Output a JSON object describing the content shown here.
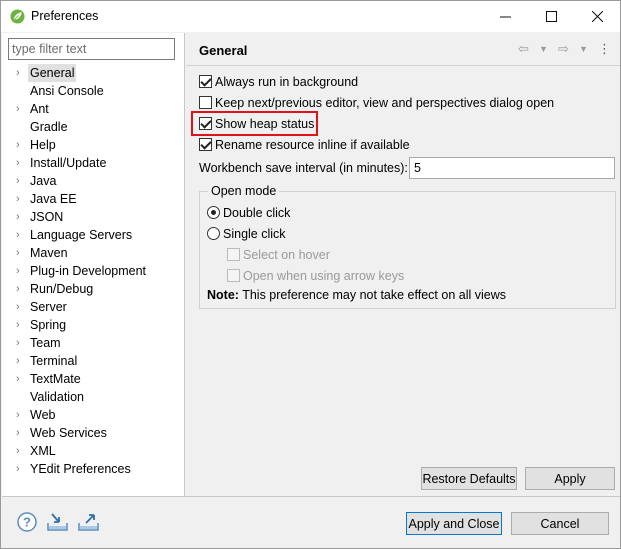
{
  "window": {
    "title": "Preferences",
    "minimize_glyph": "—",
    "maximize_glyph": "☐",
    "close_glyph": "✕"
  },
  "sidebar": {
    "filter_placeholder": "type filter text",
    "items": [
      {
        "label": "General",
        "has_arrow": true,
        "selected": true
      },
      {
        "label": "Ansi Console",
        "has_arrow": false
      },
      {
        "label": "Ant",
        "has_arrow": true
      },
      {
        "label": "Gradle",
        "has_arrow": false
      },
      {
        "label": "Help",
        "has_arrow": true
      },
      {
        "label": "Install/Update",
        "has_arrow": true
      },
      {
        "label": "Java",
        "has_arrow": true
      },
      {
        "label": "Java EE",
        "has_arrow": true
      },
      {
        "label": "JSON",
        "has_arrow": true
      },
      {
        "label": "Language Servers",
        "has_arrow": true
      },
      {
        "label": "Maven",
        "has_arrow": true
      },
      {
        "label": "Plug-in Development",
        "has_arrow": true
      },
      {
        "label": "Run/Debug",
        "has_arrow": true
      },
      {
        "label": "Server",
        "has_arrow": true
      },
      {
        "label": "Spring",
        "has_arrow": true
      },
      {
        "label": "Team",
        "has_arrow": true
      },
      {
        "label": "Terminal",
        "has_arrow": true
      },
      {
        "label": "TextMate",
        "has_arrow": true
      },
      {
        "label": "Validation",
        "has_arrow": false
      },
      {
        "label": "Web",
        "has_arrow": true
      },
      {
        "label": "Web Services",
        "has_arrow": true
      },
      {
        "label": "XML",
        "has_arrow": true
      },
      {
        "label": "YEdit Preferences",
        "has_arrow": true
      }
    ]
  },
  "main": {
    "title": "General",
    "options": [
      {
        "label": "Always run in background",
        "checked": true
      },
      {
        "label": "Keep next/previous editor, view and perspectives dialog open",
        "checked": false
      },
      {
        "label": "Show heap status",
        "checked": true,
        "highlighted": true
      },
      {
        "label": "Rename resource inline if available",
        "checked": true
      }
    ],
    "interval_label": "Workbench save interval (in minutes):",
    "interval_value": "5",
    "open_mode": {
      "legend": "Open mode",
      "double_click": "Double click",
      "single_click": "Single click",
      "select_on_hover": "Select on hover",
      "open_arrow_keys": "Open when using arrow keys",
      "selected": "double_click"
    },
    "note_bold": "Note:",
    "note_text": " This preference may not take effect on all views",
    "restore_defaults": "Restore Defaults",
    "apply": "Apply"
  },
  "footer": {
    "apply_and_close": "Apply and Close",
    "cancel": "Cancel"
  },
  "colors": {
    "highlight": "#e0121a",
    "accent": "#0078d7"
  }
}
